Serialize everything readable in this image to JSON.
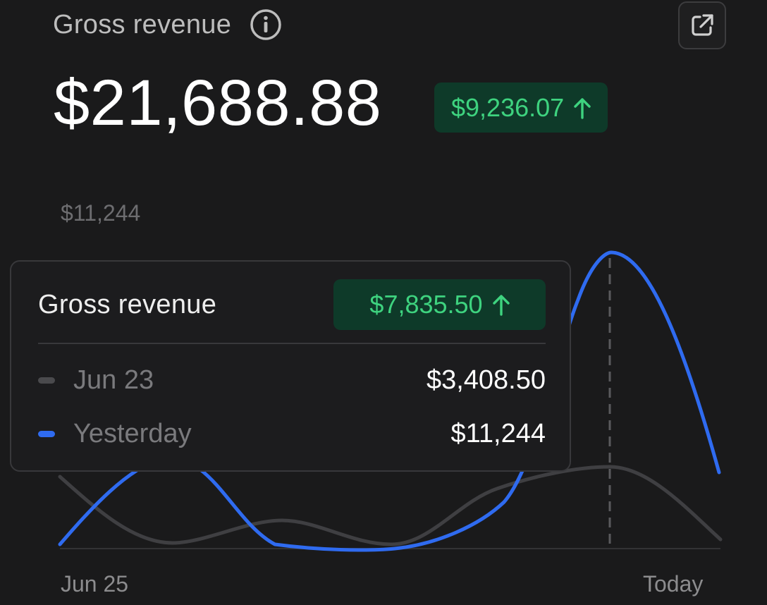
{
  "header": {
    "title": "Gross revenue",
    "value": "$21,688.88",
    "delta": "$9,236.07"
  },
  "chart": {
    "y_max_label": "$11,244",
    "x_start_label": "Jun 25",
    "x_end_label": "Today"
  },
  "tooltip": {
    "title": "Gross revenue",
    "delta": "$7,835.50",
    "rows": [
      {
        "label": "Jun 23",
        "value": "$3,408.50",
        "color": "#4a4a4d"
      },
      {
        "label": "Yesterday",
        "value": "$11,244",
        "color": "#2f6bf0"
      }
    ]
  },
  "icons": {
    "info": "info-icon",
    "open": "external-link-icon",
    "up": "arrow-up-icon"
  },
  "colors": {
    "background": "#1a1a1b",
    "positive": "#3ed37f",
    "positive_bg": "#0e3a29",
    "series_current": "#2f6bf0",
    "series_previous": "#4a4a4d"
  }
}
